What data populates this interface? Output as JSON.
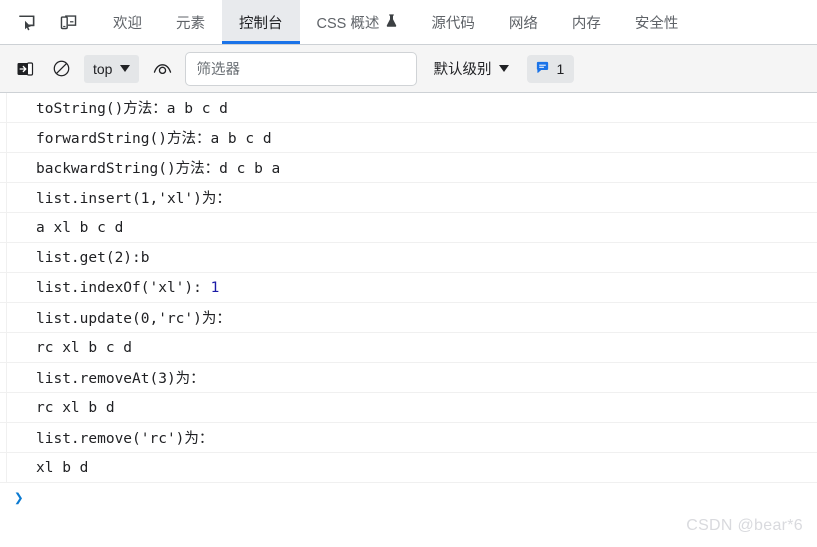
{
  "tabbar": {
    "icons": [
      {
        "name": "inspect-element-icon",
        "label": "检查元素"
      },
      {
        "name": "device-toolbar-icon",
        "label": "设备工具栏"
      }
    ],
    "tabs": [
      {
        "label": "欢迎",
        "active": false,
        "experimental": false
      },
      {
        "label": "元素",
        "active": false,
        "experimental": false
      },
      {
        "label": "控制台",
        "active": true,
        "experimental": false
      },
      {
        "label": "CSS 概述",
        "active": false,
        "experimental": true
      },
      {
        "label": "源代码",
        "active": false,
        "experimental": false
      },
      {
        "label": "网络",
        "active": false,
        "experimental": false
      },
      {
        "label": "内存",
        "active": false,
        "experimental": false
      },
      {
        "label": "安全性",
        "active": false,
        "experimental": false
      }
    ],
    "flask_glyph": "⚗"
  },
  "console_toolbar": {
    "sidebar_toggle_name": "console-sidebar-toggle-icon",
    "clear_console_name": "clear-console-icon",
    "context_value": "top",
    "live_expression_name": "live-expression-eye-icon",
    "filter_placeholder": "筛选器",
    "filter_value": "",
    "level_value": "默认级别",
    "issues_count": "1",
    "issues_icon": "message-bubble-icon"
  },
  "console": {
    "rows": [
      {
        "text": "toString()方法：a b c d"
      },
      {
        "text": "forwardString()方法：a b c d"
      },
      {
        "text": "backwardString()方法：d c b a"
      },
      {
        "text": "list.insert(1,'xl')为："
      },
      {
        "text": "a xl b c d"
      },
      {
        "text": "list.get(2):b"
      },
      {
        "text": "list.indexOf('xl'): ",
        "number": "1"
      },
      {
        "text": "list.update(0,'rc')为："
      },
      {
        "text": "rc xl b c d"
      },
      {
        "text": "list.removeAt(3)为："
      },
      {
        "text": "rc xl b d"
      },
      {
        "text": "list.remove('rc')为："
      },
      {
        "text": "xl b d"
      }
    ],
    "prompt_glyph": "❯",
    "prompt_value": ""
  },
  "watermark": {
    "text": "CSDN @bear*6"
  },
  "colors": {
    "accent_blue": "#1a73e8",
    "prompt_blue": "#0b7ad1",
    "number_blue": "#1a1aa6",
    "toolbar_bg": "#f5f5f5",
    "active_tab_bg": "#e8eaed",
    "watermark_gray": "#d9dade"
  }
}
